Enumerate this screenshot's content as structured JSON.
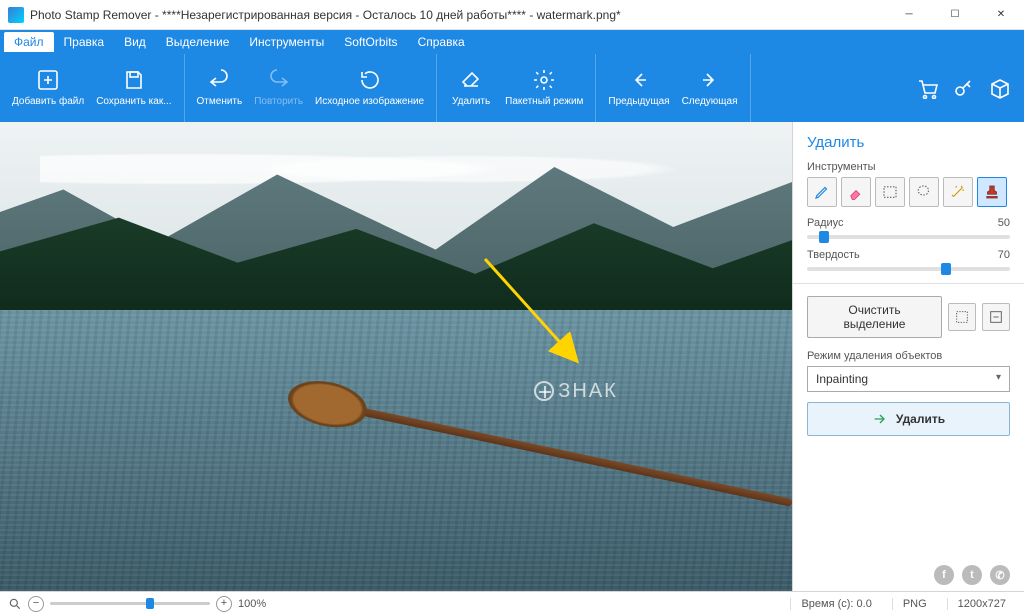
{
  "window": {
    "title": "Photo Stamp Remover - ****Незарегистрированная версия - Осталось 10 дней работы**** - watermark.png*"
  },
  "menu": {
    "items": [
      "Файл",
      "Правка",
      "Вид",
      "Выделение",
      "Инструменты",
      "SoftOrbits",
      "Справка"
    ],
    "active_index": 0
  },
  "ribbon": {
    "add_file": "Добавить файл",
    "save_as": "Сохранить как...",
    "undo": "Отменить",
    "redo": "Повторить",
    "original": "Исходное изображение",
    "remove": "Удалить",
    "batch": "Пакетный режим",
    "prev": "Предыдущая",
    "next": "Следующая"
  },
  "canvas": {
    "watermark_text": "ЗНАК"
  },
  "panel": {
    "title": "Удалить",
    "tools_label": "Инструменты",
    "tool_names": [
      "pencil",
      "eraser",
      "rect-select",
      "lasso",
      "magic-wand",
      "stamp"
    ],
    "radius_label": "Радиус",
    "radius_value": "50",
    "hardness_label": "Твердость",
    "hardness_value": "70",
    "clear_selection": "Очистить выделение",
    "mode_label": "Режим удаления объектов",
    "mode_value": "Inpainting",
    "remove_button": "Удалить"
  },
  "status": {
    "zoom_pct": "100%",
    "time_label": "Время (с): 0.0",
    "format": "PNG",
    "dimensions": "1200x727"
  }
}
